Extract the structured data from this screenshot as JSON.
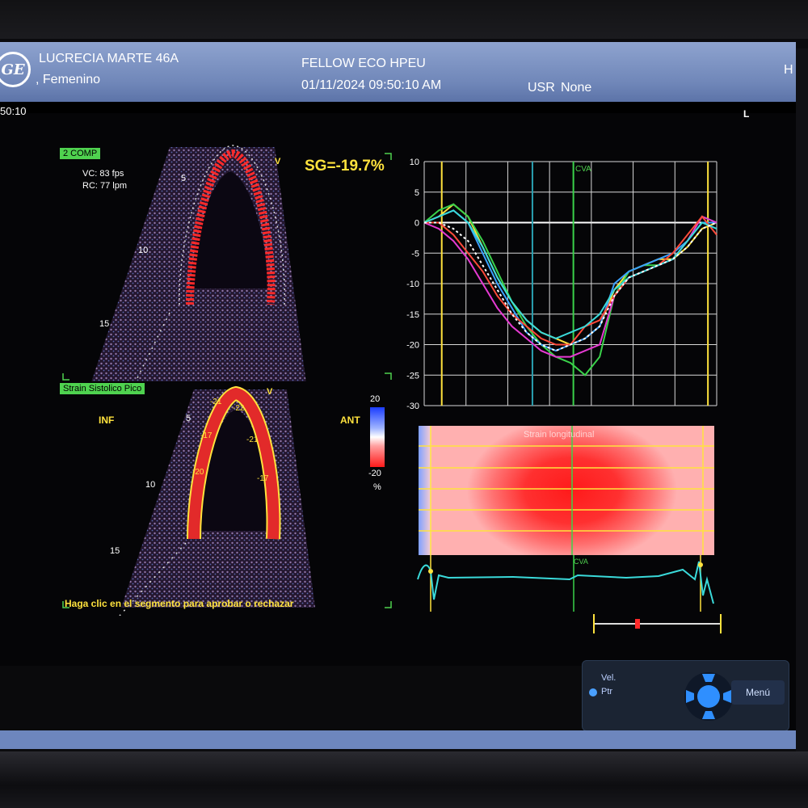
{
  "header": {
    "patient_name": "LUCRECIA MARTE 46A",
    "patient_sex": ", Femenino",
    "institution": "FELLOW ECO HPEU",
    "datetime": "01/11/2024 09:50:10 AM",
    "user_label": "USR",
    "user_value": "None",
    "logo": "GE",
    "corner_char": "H"
  },
  "status": {
    "time": "50:10",
    "orientation": "L"
  },
  "upper_view": {
    "mode_badge": "2 COMP",
    "frame_rate": "VC: 83 fps",
    "heart_rate": "RC: 77 lpm",
    "v_marker": "V",
    "depth_marks": [
      "5",
      "10",
      "15"
    ],
    "global_strain": "SG=-19.7%"
  },
  "lower_view": {
    "mode_badge": "Strain Sistolico Pico",
    "v_marker": "V",
    "wall_left": "INF",
    "wall_right": "ANT",
    "depth_marks": [
      "5",
      "10",
      "15"
    ],
    "segment_values": [
      "-21",
      "-22",
      "-17",
      "-21",
      "-20",
      "-17"
    ],
    "instruction": "Haga clic en el segmento para aprobar o rechazar"
  },
  "colorbar": {
    "max": "20",
    "min": "-20",
    "unit": "%"
  },
  "strain_chart": {
    "y_ticks": [
      "10",
      "5",
      "0",
      "-5",
      "-10",
      "-15",
      "-20",
      "-25",
      "-30"
    ],
    "marker": "CVA"
  },
  "parametric": {
    "title": "Strain longitudinal",
    "marker": "CVA"
  },
  "controls": {
    "vel_label": "Vel.",
    "ptr_label": "Ptr",
    "menu_label": "Menú"
  },
  "icons": [
    "ge-logo",
    "dpad-icon",
    "radio-icon"
  ],
  "colors": {
    "header_blue": "#7a90c2",
    "badge_green": "#4fd24f",
    "label_yellow": "#ffe23d",
    "strain_red": "#ff2a2a"
  },
  "chart_data": {
    "type": "line",
    "ylim": [
      -30,
      10
    ],
    "yticks": [
      10,
      5,
      0,
      -5,
      -10,
      -15,
      -20,
      -25,
      -30
    ],
    "xlim": [
      0,
      100
    ],
    "x": [
      0,
      5,
      10,
      15,
      20,
      25,
      30,
      35,
      40,
      45,
      50,
      55,
      60,
      65,
      70,
      75,
      80,
      85,
      90,
      95,
      100
    ],
    "series": [
      {
        "color": "#ffe23d",
        "values": [
          0,
          1,
          3,
          1,
          -4,
          -9,
          -13,
          -16,
          -18,
          -19,
          -20,
          -19,
          -17,
          -11,
          -8,
          -7,
          -6,
          -6,
          -4,
          -1,
          0
        ]
      },
      {
        "color": "#3ad24a",
        "values": [
          0,
          2,
          3,
          1,
          -3,
          -8,
          -13,
          -17,
          -20,
          -22,
          -23,
          -25,
          -22,
          -12,
          -8,
          -7,
          -7,
          -6,
          -3,
          1,
          0
        ]
      },
      {
        "color": "#3aa0ff",
        "values": [
          0,
          1,
          2,
          0,
          -5,
          -10,
          -14,
          -18,
          -20,
          -21,
          -20,
          -19,
          -17,
          -10,
          -8,
          -7,
          -6,
          -5,
          -3,
          0,
          0
        ]
      },
      {
        "color": "#e63ad2",
        "values": [
          0,
          -1,
          -3,
          -6,
          -10,
          -14,
          -17,
          -19,
          -21,
          -22,
          -22,
          -21,
          -20,
          -12,
          -9,
          -8,
          -7,
          -6,
          -3,
          1,
          0
        ]
      },
      {
        "color": "#ff4a3a",
        "values": [
          0,
          0,
          -2,
          -5,
          -8,
          -12,
          -15,
          -17,
          -19,
          -20,
          -20,
          -17,
          -16,
          -12,
          -9,
          -8,
          -7,
          -5,
          -2,
          1,
          -2
        ]
      },
      {
        "color": "#3adada",
        "values": [
          0,
          1,
          2,
          0,
          -4,
          -9,
          -13,
          -16,
          -18,
          -19,
          -18,
          -17,
          -15,
          -11,
          -9,
          -8,
          -7,
          -6,
          -3,
          0,
          -1
        ]
      },
      {
        "color": "#ffffff",
        "values": [
          0,
          0,
          -1,
          -3,
          -7,
          -11,
          -15,
          -18,
          -20,
          -21,
          -20,
          -19,
          -17,
          -12,
          -9,
          -8,
          -7,
          -6,
          -4,
          -1,
          0
        ]
      }
    ],
    "annotations": [
      "CVA"
    ]
  }
}
